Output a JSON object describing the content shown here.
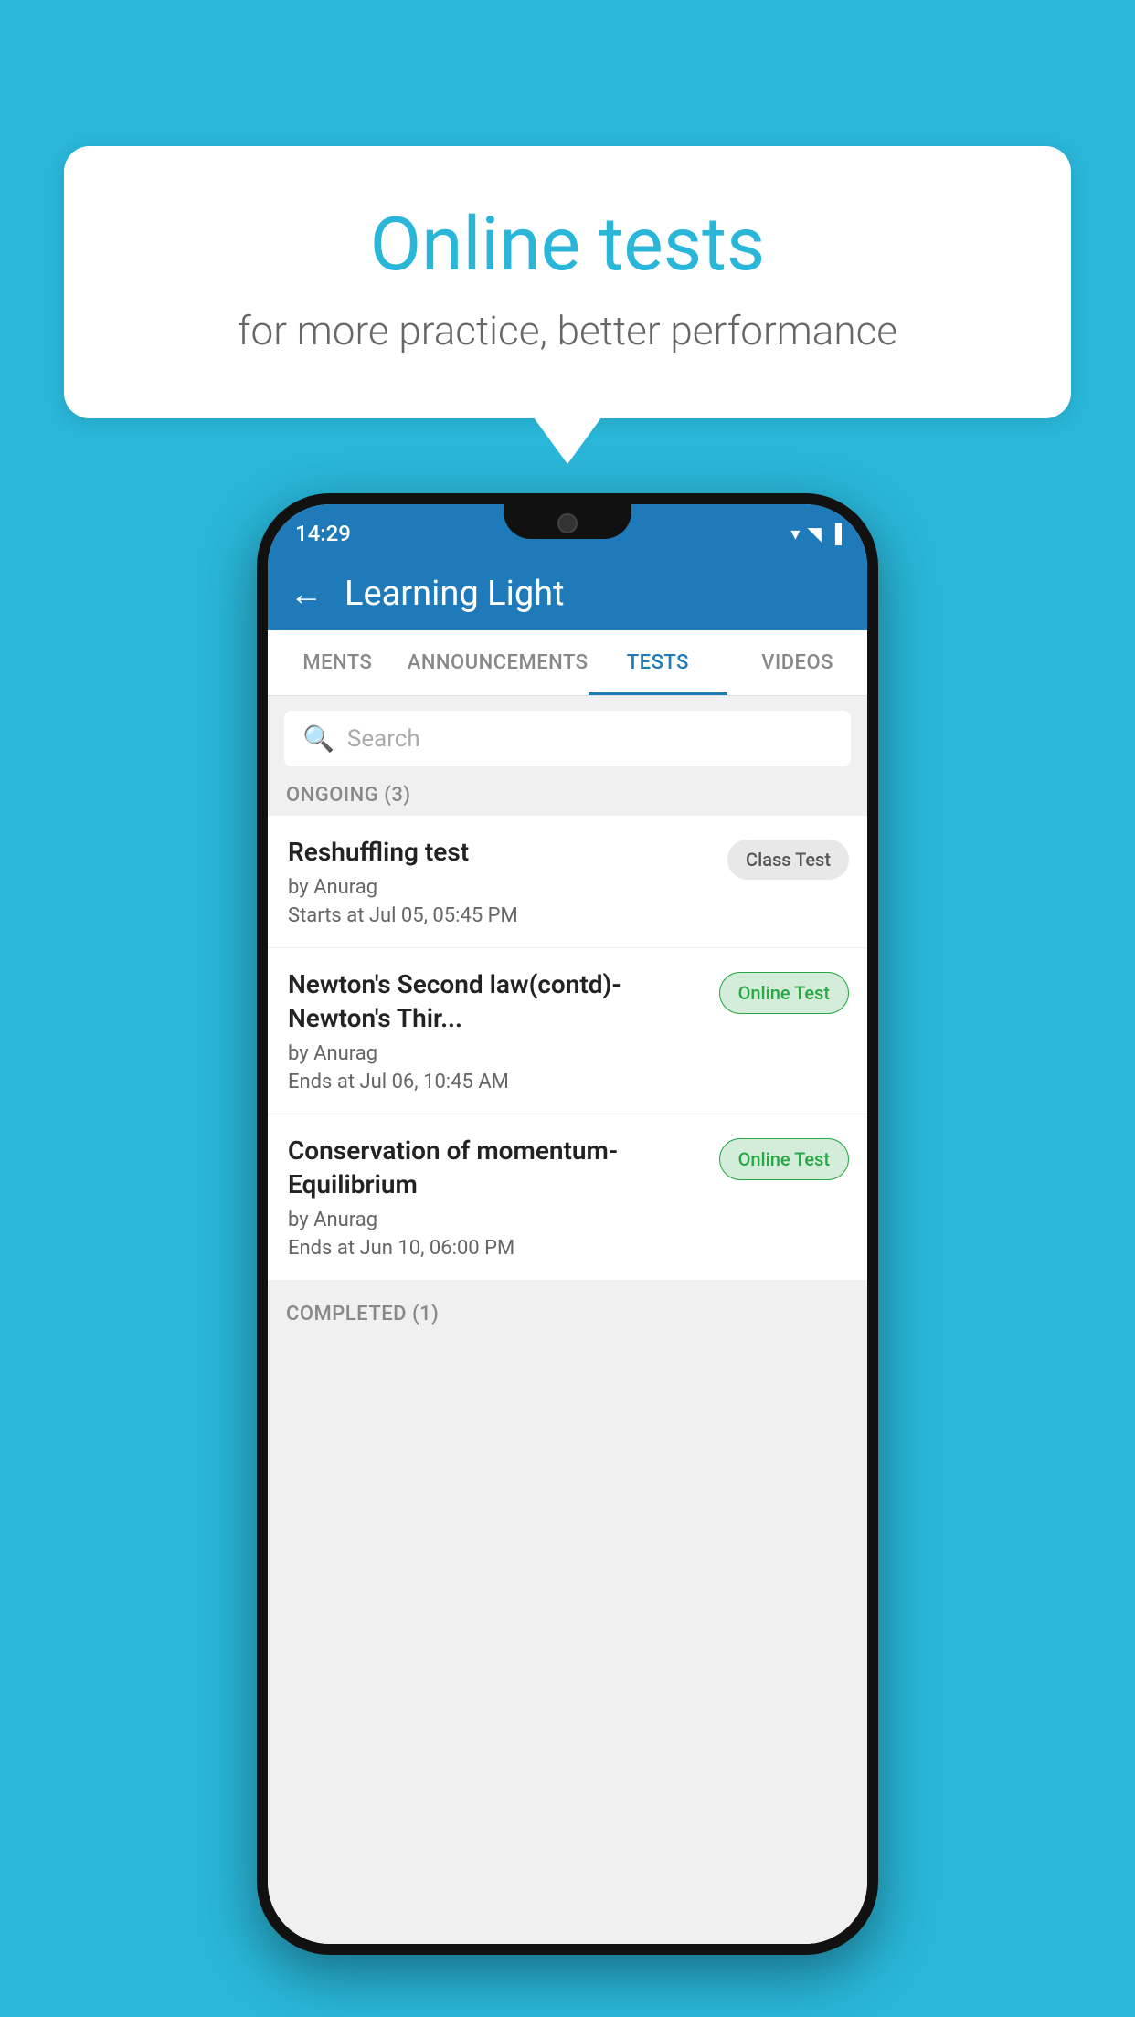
{
  "background_color": "#29b6d8",
  "bubble": {
    "title": "Online tests",
    "subtitle": "for more practice, better performance"
  },
  "phone": {
    "status_bar": {
      "time": "14:29",
      "wifi": "▾",
      "signal": "▲",
      "battery": "▌"
    },
    "header": {
      "back_label": "←",
      "title": "Learning Light"
    },
    "tabs": [
      {
        "label": "MENTS",
        "active": false
      },
      {
        "label": "ANNOUNCEMENTS",
        "active": false
      },
      {
        "label": "TESTS",
        "active": true
      },
      {
        "label": "VIDEOS",
        "active": false
      }
    ],
    "search": {
      "placeholder": "Search"
    },
    "sections": [
      {
        "header": "ONGOING (3)",
        "items": [
          {
            "name": "Reshuffling test",
            "author": "by Anurag",
            "date": "Starts at  Jul 05, 05:45 PM",
            "badge": "Class Test",
            "badge_type": "class"
          },
          {
            "name": "Newton's Second law(contd)-Newton's Thir...",
            "author": "by Anurag",
            "date": "Ends at  Jul 06, 10:45 AM",
            "badge": "Online Test",
            "badge_type": "online"
          },
          {
            "name": "Conservation of momentum-Equilibrium",
            "author": "by Anurag",
            "date": "Ends at  Jun 10, 06:00 PM",
            "badge": "Online Test",
            "badge_type": "online"
          }
        ]
      }
    ],
    "completed_header": "COMPLETED (1)"
  }
}
